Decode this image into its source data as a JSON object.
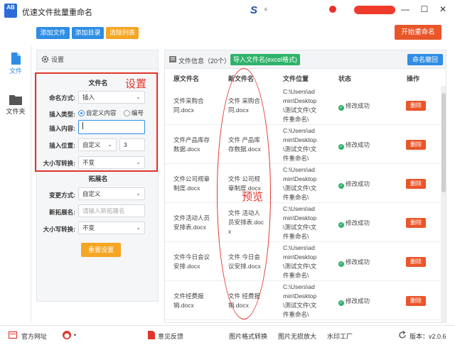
{
  "window": {
    "title": "优速文件批量重命名",
    "logo_text": "AB",
    "brand_mark": "S",
    "brand_sub": "≤",
    "controls": {
      "minimize": "—",
      "restore": "☐",
      "close": "✕"
    }
  },
  "toolbar": {
    "add_file": "添加文件",
    "add_dir": "添加目录",
    "clear_list": "清除列表",
    "start": "开始重命名"
  },
  "sidebar": {
    "items": [
      {
        "label": "文件",
        "icon": "file-icon",
        "active": true
      },
      {
        "label": "文件夹",
        "icon": "folder-icon",
        "active": false
      }
    ]
  },
  "settings": {
    "header": "设置",
    "annotation": "设置",
    "filename": {
      "title": "文件名",
      "mode_label": "命名方式:",
      "mode_value": "插入",
      "insert_type_label": "插入类型:",
      "insert_type_options": [
        "自定义内容",
        "编号"
      ],
      "insert_type_selected": "自定义内容",
      "insert_content_label": "插入内容:",
      "insert_content_value": "",
      "insert_pos_label": "插入位置:",
      "insert_pos_value": "自定义",
      "insert_pos_number": "3",
      "case_label": "大小写转换:",
      "case_value": "不变"
    },
    "extension": {
      "title": "拓展名",
      "mode_label": "变更方式:",
      "mode_value": "自定义",
      "new_ext_label": "新拓展名:",
      "new_ext_placeholder": "请输入新拓展名",
      "case_label": "大小写转换:",
      "case_value": "不变"
    },
    "reset": "重置设置"
  },
  "file_list": {
    "title": "文件信息（20个）",
    "import_button": "导入文件名(excel格式)",
    "undo_button": "命名撤回",
    "annotation": "预览",
    "columns": [
      "原文件名",
      "新文件名",
      "文件位置",
      "状态",
      "操作"
    ],
    "rows": [
      {
        "original": "文件采购合\n同.docx",
        "new": "文件 采购合\n同.docx",
        "location": "C:\\Users\\ad\nmin\\Desktop\n\\测试文件\\文\n件重命名\\",
        "status": "修改成功",
        "action": "删除"
      },
      {
        "original": "文件产品库存\n数据.docx",
        "new": "文件 产品库\n存数据.docx",
        "location": "C:\\Users\\ad\nmin\\Desktop\n\\测试文件\\文\n件重命名\\",
        "status": "修改成功",
        "action": "删除"
      },
      {
        "original": "文件公司规章\n制度.docx",
        "new": "文件 公司规\n章制度.docx",
        "location": "C:\\Users\\ad\nmin\\Desktop\n\\测试文件\\文\n件重命名\\",
        "status": "修改成功",
        "action": "删除"
      },
      {
        "original": "文件活动人员\n安排表.docx",
        "new": "文件 活动人\n员安排表.doc\nx",
        "location": "C:\\Users\\ad\nmin\\Desktop\n\\测试文件\\文\n件重命名\\",
        "status": "修改成功",
        "action": "删除"
      },
      {
        "original": "文件今日会议\n安排.docx",
        "new": "文件 今日会\n议安排.docx",
        "location": "C:\\Users\\ad\nmin\\Desktop\n\\测试文件\\文\n件重命名\\",
        "status": "修改成功",
        "action": "删除"
      },
      {
        "original": "文件经费报\n销.docx",
        "new": "文件 经费报\n销.docx",
        "location": "C:\\Users\\ad\nmin\\Desktop\n\\测试文件\\文\n件重命名\\",
        "status": "修改成功",
        "action": "删除"
      }
    ]
  },
  "footer": {
    "website": "官方网址",
    "user": "•",
    "feedback": "意见反馈",
    "img_convert": "图片格式转换",
    "img_enlarge": "图片无损放大",
    "watermark": "水印工厂",
    "version": "版本：v2.0.6"
  },
  "colors": {
    "blue": "#2f8de4",
    "orange": "#f5a623",
    "red_orange": "#e8562a",
    "green": "#2fb36b",
    "annotation_red": "#e0352b"
  }
}
